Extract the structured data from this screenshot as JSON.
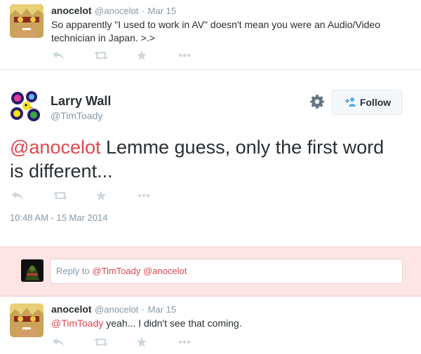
{
  "tweet_top": {
    "name": "anocelot",
    "handle": "@anocelot",
    "sep": "·",
    "date": "Mar 15",
    "text": "So apparently \"I used to work in AV\" doesn't mean you were an Audio/Video technician in Japan. >.>"
  },
  "main_tweet": {
    "name": "Larry Wall",
    "handle": "@TimToady",
    "follow_label": "Follow",
    "mention": "@anocelot",
    "text": " Lemme guess, only the first word is different...",
    "timestamp": "10:48 AM - 15 Mar 2014"
  },
  "reply": {
    "prefix": "Reply to ",
    "mentions": "@TimToady @anocelot"
  },
  "tweet_bottom": {
    "name": "anocelot",
    "handle": "@anocelot",
    "sep": "·",
    "date": "Mar 15",
    "mention": "@TimToady",
    "text": " yeah... I didn't see that coming."
  },
  "icons": {
    "reply": "reply-icon",
    "retweet": "retweet-icon",
    "favorite": "star-icon",
    "more": "more-icon",
    "gear": "gear-icon",
    "follow": "add-user-icon"
  },
  "colors": {
    "mention": "#e0464f",
    "reply_bg": "#fde5e6",
    "muted": "#8899a6",
    "icon": "#ccd6dd"
  }
}
